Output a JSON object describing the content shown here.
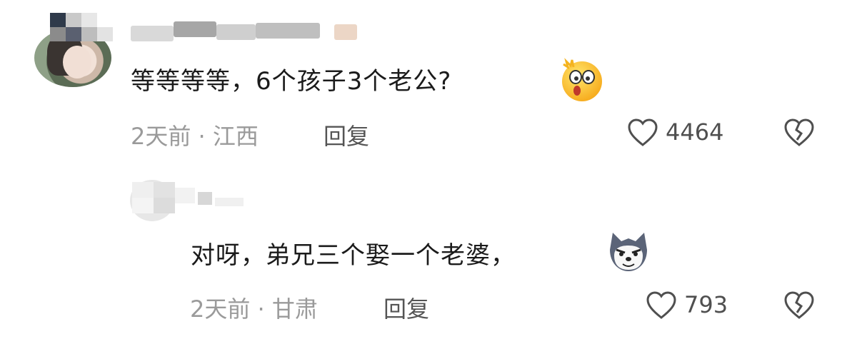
{
  "comments": [
    {
      "text": "等等等等，6个孩子3个老公?",
      "emoji": "astonished-face-icon",
      "time_location": "2天前 · 江西",
      "reply_label": "回复",
      "like_count": "4464"
    },
    {
      "text": "对呀，弟兄三个娶一个老婆，",
      "emoji": "wolf-face-icon",
      "time_location": "2天前 · 甘肃",
      "reply_label": "回复",
      "like_count": "793"
    }
  ],
  "colors": {
    "text_primary": "#1b1b1b",
    "text_meta": "#9a9a9a",
    "icon": "#4f4f4f"
  }
}
